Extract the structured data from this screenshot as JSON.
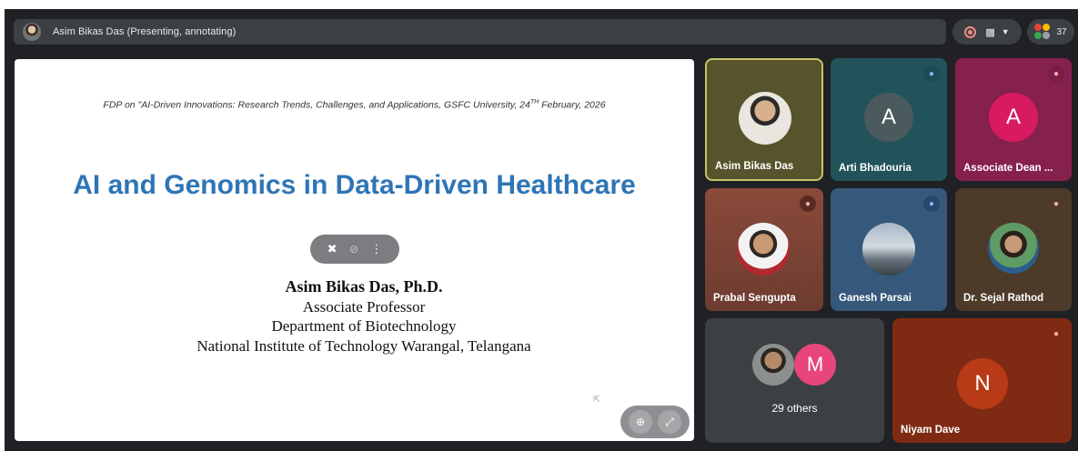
{
  "topbar": {
    "presenter_label": "Asim Bikas Das (Presenting, annotating)",
    "participant_count": "37"
  },
  "slide": {
    "header_prefix": "FDP on \"AI-Driven Innovations: Research Trends, Challenges, and Applications, GSFC University, 24",
    "header_sup": "TH",
    "header_suffix": " February, 2026",
    "title": "AI and Genomics in Data-Driven Healthcare",
    "author_name": "Asim Bikas Das, Ph.D.",
    "author_role": "Associate Professor",
    "author_dept": "Department of Biotechnology",
    "author_inst": "National Institute of Technology Warangal, Telangana"
  },
  "tiles": [
    {
      "name": "Asim Bikas Das"
    },
    {
      "name": "Arti Bhadouria",
      "initial": "A"
    },
    {
      "name": "Associate Dean ...",
      "initial": "A"
    },
    {
      "name": "Prabal Sengupta"
    },
    {
      "name": "Ganesh Parsai"
    },
    {
      "name": "Dr. Sejal Rathod"
    },
    {
      "label": "29 others",
      "initial": "M"
    },
    {
      "name": "Niyam Dave",
      "initial": "N"
    }
  ],
  "colors": {
    "slide_title": "#2e75b6",
    "meeting_bg": "#202124",
    "recording": "#f28b82"
  }
}
